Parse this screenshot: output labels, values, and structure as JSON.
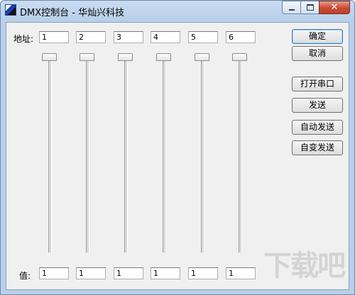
{
  "window": {
    "title": "DMX控制台 - 华灿兴科技",
    "close_glyph": "✕"
  },
  "labels": {
    "address": "地址:",
    "value": "值:"
  },
  "address_fields": [
    "1",
    "2",
    "3",
    "4",
    "5",
    "6"
  ],
  "value_fields": [
    "1",
    "1",
    "1",
    "1",
    "1",
    "1"
  ],
  "sliders": {
    "levels": [
      0,
      0,
      0,
      0,
      0,
      0
    ]
  },
  "buttons": {
    "ok": "确定",
    "cancel": "取消",
    "open_port": "打开串口",
    "send": "发送",
    "auto_send": "自动发送",
    "auto_change_send": "自变发送"
  },
  "watermark": {
    "text": "下载吧"
  },
  "colors": {
    "titlebar": "#b9d0ea",
    "close_button": "#c94b32",
    "client_bg": "#f0f0f0"
  }
}
